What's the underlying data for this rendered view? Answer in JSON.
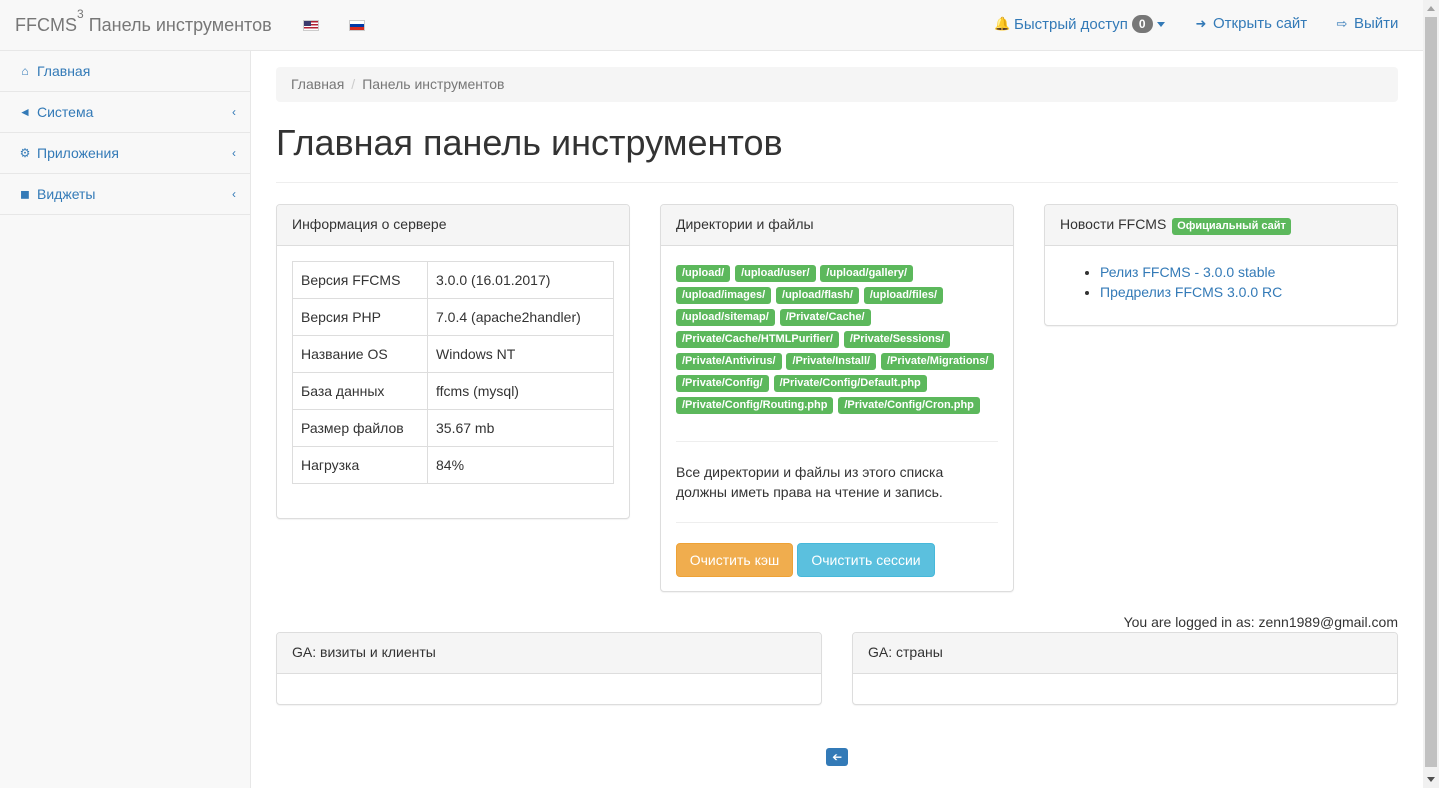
{
  "navbar": {
    "brand_prefix": "FFCMS",
    "brand_sup": "3",
    "brand_suffix": " Панель инструментов",
    "quick_access": "Быстрый доступ",
    "quick_count": "0",
    "open_site": "Открыть сайт",
    "logout": "Выйти"
  },
  "sidebar": {
    "items": [
      {
        "label": "Главная",
        "icon": "home-icon"
      },
      {
        "label": "Система",
        "icon": "fire-icon"
      },
      {
        "label": "Приложения",
        "icon": "plug-icon"
      },
      {
        "label": "Виджеты",
        "icon": "puzzle-icon"
      }
    ]
  },
  "breadcrumb": {
    "home": "Главная",
    "current": "Панель инструментов"
  },
  "page_title": "Главная панель инструментов",
  "server_panel": {
    "title": "Информация о сервере",
    "rows": [
      {
        "k": "Версия FFCMS",
        "v": "3.0.0 (16.01.2017)"
      },
      {
        "k": "Версия PHP",
        "v": "7.0.4 (apache2handler)"
      },
      {
        "k": "Название OS",
        "v": "Windows NT"
      },
      {
        "k": "База данных",
        "v": "ffcms (mysql)"
      },
      {
        "k": "Размер файлов",
        "v": "35.67 mb"
      },
      {
        "k": "Нагрузка",
        "v": "84%"
      }
    ]
  },
  "dirs_panel": {
    "title": "Директории и файлы",
    "paths": [
      "/upload/",
      "/upload/user/",
      "/upload/gallery/",
      "/upload/images/",
      "/upload/flash/",
      "/upload/files/",
      "/upload/sitemap/",
      "/Private/Cache/",
      "/Private/Cache/HTMLPurifier/",
      "/Private/Sessions/",
      "/Private/Antivirus/",
      "/Private/Install/",
      "/Private/Migrations/",
      "/Private/Config/",
      "/Private/Config/Default.php",
      "/Private/Config/Routing.php",
      "/Private/Config/Cron.php"
    ],
    "note": "Все директории и файлы из этого списка должны иметь права на чтение и запись.",
    "clear_cache": "Очистить кэш",
    "clear_sessions": "Очистить сессии"
  },
  "news_panel": {
    "title": "Новости FFCMS",
    "badge": "Официальный сайт",
    "items": [
      "Релиз FFCMS - 3.0.0 stable",
      "Предрелиз FFCMS 3.0.0 RC"
    ]
  },
  "logged_in": "You are logged in as: zenn1989@gmail.com",
  "ga_visits": {
    "title": "GA: визиты и клиенты"
  },
  "ga_countries": {
    "title": "GA: страны"
  },
  "colors": {
    "primary": "#337ab7",
    "success": "#5cb85c",
    "warning": "#f0ad4e",
    "info": "#5bc0de"
  }
}
